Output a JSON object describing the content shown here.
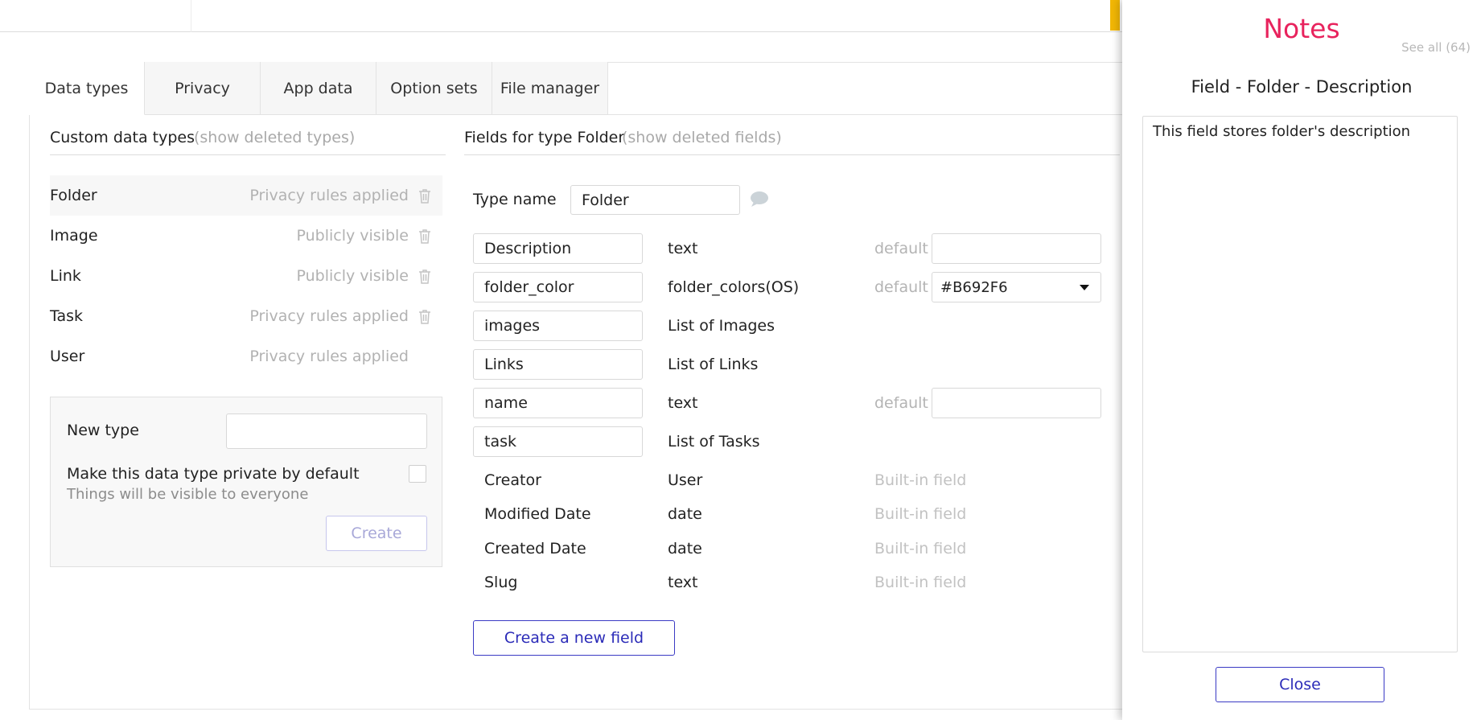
{
  "tabs": [
    {
      "label": "Data types",
      "active": true
    },
    {
      "label": "Privacy",
      "active": false
    },
    {
      "label": "App data",
      "active": false
    },
    {
      "label": "Option sets",
      "active": false
    },
    {
      "label": "File manager",
      "active": false
    }
  ],
  "custom_types": {
    "title": "Custom data types",
    "show_deleted": "(show deleted types)",
    "items": [
      {
        "name": "Folder",
        "status": "Privacy rules applied",
        "deletable": true,
        "selected": true
      },
      {
        "name": "Image",
        "status": "Publicly visible",
        "deletable": true,
        "selected": false
      },
      {
        "name": "Link",
        "status": "Publicly visible",
        "deletable": true,
        "selected": false
      },
      {
        "name": "Task",
        "status": "Privacy rules applied",
        "deletable": true,
        "selected": false
      },
      {
        "name": "User",
        "status": "Privacy rules applied",
        "deletable": false,
        "selected": false
      }
    ]
  },
  "new_type": {
    "label": "New type",
    "input_value": "",
    "private_label": "Make this data type private by default",
    "private_sub": "Things will be visible to everyone",
    "private_checked": false,
    "create_label": "Create"
  },
  "fields": {
    "title": "Fields for type Folder",
    "show_deleted": "(show deleted fields)",
    "type_name_label": "Type name",
    "type_name_value": "Folder",
    "default_label": "default",
    "items": [
      {
        "name": "Description",
        "type": "text",
        "default": "",
        "kind": "input"
      },
      {
        "name": "folder_color",
        "type": "folder_colors(OS)",
        "default": "#B692F6",
        "kind": "select"
      },
      {
        "name": "images",
        "type": "List of Images",
        "kind": "none"
      },
      {
        "name": "Links",
        "type": "List of Links",
        "kind": "none"
      },
      {
        "name": "name",
        "type": "text",
        "default": "",
        "kind": "input"
      },
      {
        "name": "task",
        "type": "List of Tasks",
        "kind": "none"
      }
    ],
    "builtin": [
      {
        "name": "Creator",
        "type": "User",
        "label": "Built-in field"
      },
      {
        "name": "Modified Date",
        "type": "date",
        "label": "Built-in field"
      },
      {
        "name": "Created Date",
        "type": "date",
        "label": "Built-in field"
      },
      {
        "name": "Slug",
        "type": "text",
        "label": "Built-in field"
      }
    ],
    "create_label": "Create a new field"
  },
  "notes": {
    "title": "Notes",
    "see_all": "See all (64)",
    "subtitle": "Field - Folder - Description",
    "text": "This field stores folder's description",
    "close_label": "Close"
  },
  "colors": {
    "accent_pink": "#e8235d",
    "button_blue": "#2b2bb8",
    "topbar_yellow": "#f2b705"
  },
  "icons": {
    "trash": "trash-icon",
    "note": "speech-bubble-icon",
    "caret": "caret-down-icon"
  }
}
